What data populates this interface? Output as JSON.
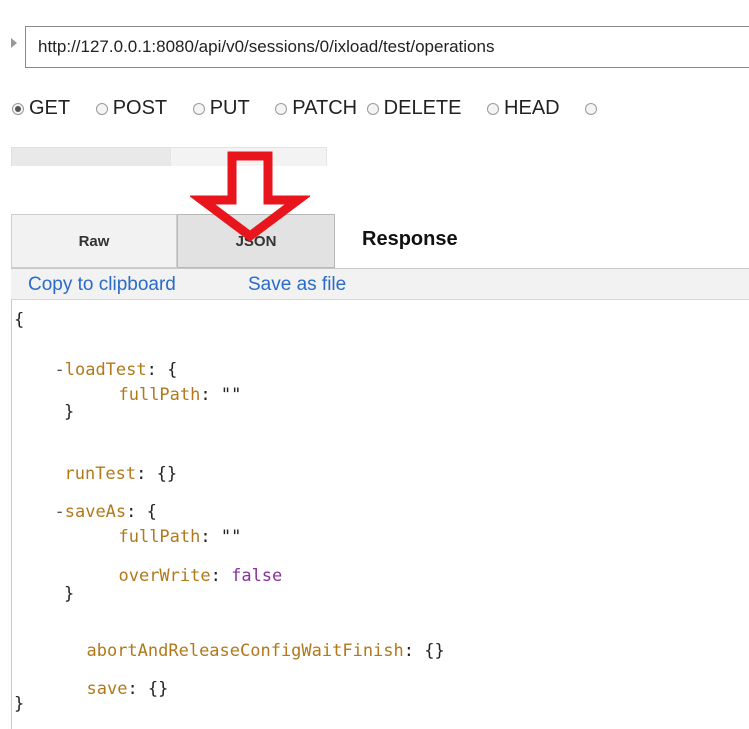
{
  "request": {
    "url": "http://127.0.0.1:8080/api/v0/sessions/0/ixload/test/operations",
    "methods": [
      {
        "label": "GET",
        "checked": true
      },
      {
        "label": "POST",
        "checked": false
      },
      {
        "label": "PUT",
        "checked": false
      },
      {
        "label": "PATCH",
        "checked": false
      },
      {
        "label": "DELETE",
        "checked": false
      },
      {
        "label": "HEAD",
        "checked": false
      }
    ]
  },
  "tabs": {
    "raw": "Raw",
    "json": "JSON",
    "response": "Response"
  },
  "actions": {
    "copy": "Copy to clipboard",
    "save": "Save as file"
  },
  "json_tree": {
    "open_brace": "{",
    "close_brace": "}",
    "collapse": "-",
    "loadTest_key": "loadTest",
    "fullPath_key": "fullPath",
    "fullPath_value": "\"\"",
    "runTest_key": "runTest",
    "empty_obj": "{}",
    "saveAs_key": "saveAs",
    "overWrite_key": "overWrite",
    "overWrite_value": "false",
    "abort_key": "abortAndReleaseConfigWaitFinish",
    "save_key": "save",
    "colon": ": ",
    "colon_brace": ": {"
  },
  "annotation": {
    "arrow_color": "#e8151c"
  },
  "colors": {
    "link": "#2a6bc9",
    "key": "#b2781a",
    "bool": "#8a2f9e"
  }
}
